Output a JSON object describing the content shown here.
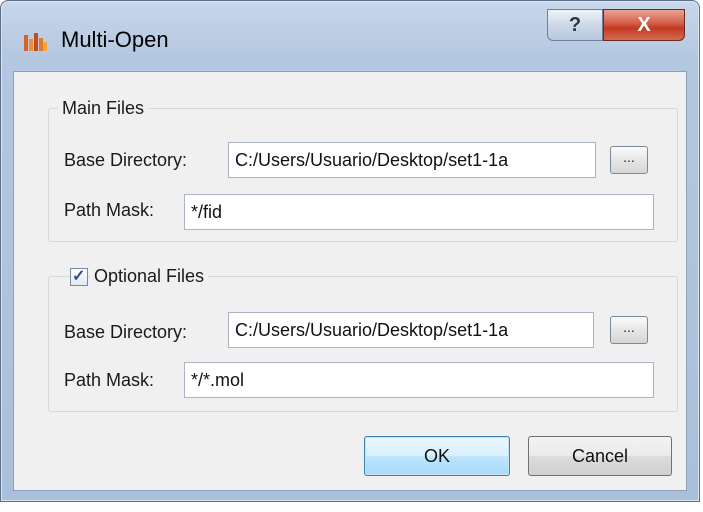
{
  "window": {
    "title": "Multi-Open",
    "help_label": "?",
    "close_label": "X",
    "icon": "app-icon"
  },
  "main_files": {
    "legend": "Main Files",
    "base_dir_label": "Base Directory:",
    "base_dir_value": "C:/Users/Usuario/Desktop/set1-1a",
    "browse_label": "...",
    "mask_label": "Path Mask:",
    "mask_value": "*/fid"
  },
  "optional_files": {
    "legend": "Optional Files",
    "checked": true,
    "checkmark": "✓",
    "base_dir_label": "Base Directory:",
    "base_dir_value": "C:/Users/Usuario/Desktop/set1-1a",
    "browse_label": "...",
    "mask_label": "Path Mask:",
    "mask_value": "*/*.mol"
  },
  "buttons": {
    "ok": "OK",
    "cancel": "Cancel"
  }
}
